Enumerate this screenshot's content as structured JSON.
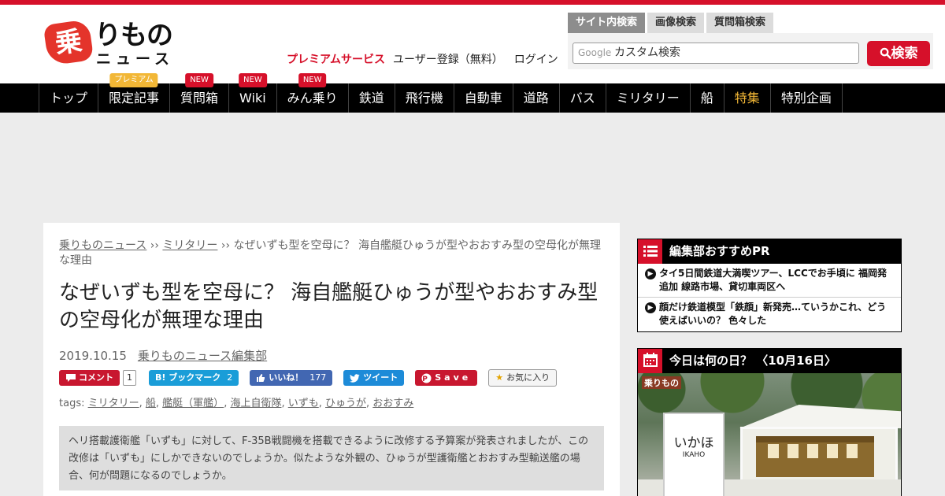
{
  "colors": {
    "brand": "#d6102a",
    "nav_bg": "#000000",
    "featured": "#f2b736"
  },
  "logo": {
    "mark": "乗",
    "top": "りもの",
    "bottom": "ニュース"
  },
  "search": {
    "tabs": [
      "サイト内検索",
      "画像検索",
      "質問箱検索"
    ],
    "provider": "Google",
    "placeholder": "カスタム検索",
    "button_label": "検索",
    "button_icon": "search-icon"
  },
  "header_links": {
    "premium": "プレミアムサービス",
    "register": "ユーザー登録（無料）",
    "login": "ログイン"
  },
  "nav": {
    "items": [
      {
        "label": "トップ",
        "badge": ""
      },
      {
        "label": "限定記事",
        "badge": "プレミアム"
      },
      {
        "label": "質問箱",
        "badge": "NEW"
      },
      {
        "label": "Wiki",
        "badge": "NEW"
      },
      {
        "label": "みん乗り",
        "badge": "NEW"
      },
      {
        "label": "鉄道",
        "badge": ""
      },
      {
        "label": "飛行機",
        "badge": ""
      },
      {
        "label": "自動車",
        "badge": ""
      },
      {
        "label": "道路",
        "badge": ""
      },
      {
        "label": "バス",
        "badge": ""
      },
      {
        "label": "ミリタリー",
        "badge": ""
      },
      {
        "label": "船",
        "badge": ""
      },
      {
        "label": "特集",
        "badge": ""
      },
      {
        "label": "特別企画",
        "badge": ""
      }
    ]
  },
  "article": {
    "breadcrumb": {
      "home": "乗りものニュース",
      "separator": " ›› ",
      "category": "ミリタリー",
      "current": "なぜいずも型を空母に？ 海自艦艇ひゅうが型やおおすみ型の空母化が無理な理由"
    },
    "title": "なぜいずも型を空母に？ 海自艦艇ひゅうが型やおおすみ型の空母化が無理な理由",
    "date": "2019.10.15",
    "author": "乗りものニュース編集部",
    "share": {
      "comment_label": "コメント",
      "comment_count": "1",
      "hatena_label": "B! ブックマーク",
      "hatena_count": "2",
      "like_label": "いいね！",
      "like_count": "177",
      "tweet_label": "ツイート",
      "pin_label": "Save",
      "fav_label": "お気に入り"
    },
    "tags_label": "tags: ",
    "tags": [
      "ミリタリー",
      "船",
      "艦艇（軍艦）",
      "海上自衛隊",
      "いずも",
      "ひゅうが",
      "おおすみ"
    ],
    "lead": "ヘリ搭載護衛艦「いずも」に対して、F-35B戦闘機を搭載できるように改修する予算案が発表されましたが、この改修は「いずも」にしかできないのでしょうか。似たような外観の、ひゅうが型護衛艦とおおすみ型輸送艦の場合、何が問題になるのでしょうか。"
  },
  "sidebar": {
    "pr": {
      "title": "編集部おすすめPR",
      "icon": "list-icon",
      "items": [
        "タイ5日間鉄道大満喫ツアー、LCCでお手頃に 福岡発追加 線路市場、貸切車両区へ",
        "顔だけ鉄道模型「鉄顔」新発売…ていうかこれ、どう使えばいいの？ 色々した"
      ]
    },
    "today": {
      "title": "今日は何の日？ 〈10月16日〉",
      "icon": "calendar-icon",
      "photo_logo": "乗りもの",
      "sign_main": "いかほ",
      "sign_sub": "IKAHO"
    }
  }
}
